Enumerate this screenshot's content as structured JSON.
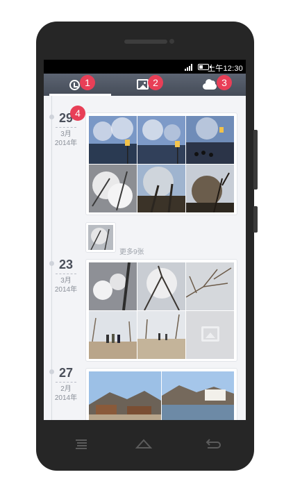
{
  "statusbar": {
    "time": "上午12:30"
  },
  "tabs": [
    {
      "id": "timeline",
      "icon": "clock-icon",
      "badge": "1",
      "active": true
    },
    {
      "id": "albums",
      "icon": "image-icon",
      "badge": "2",
      "active": false
    },
    {
      "id": "cloud",
      "icon": "cloud-icon",
      "badge": "3",
      "active": false
    }
  ],
  "annotation_badge": "4",
  "groups": [
    {
      "day": "29",
      "month": "3月",
      "year": "2014年",
      "more_label": "更多9张"
    },
    {
      "day": "23",
      "month": "3月",
      "year": "2014年"
    },
    {
      "day": "27",
      "month": "2月",
      "year": "2014年"
    }
  ],
  "nav": [
    {
      "icon": "menu-icon"
    },
    {
      "icon": "home-icon"
    },
    {
      "icon": "back-icon"
    }
  ],
  "colors": {
    "badge": "#e83f57",
    "tabbar": "#505866",
    "background": "#f3f4f7",
    "phone": "#262626"
  }
}
